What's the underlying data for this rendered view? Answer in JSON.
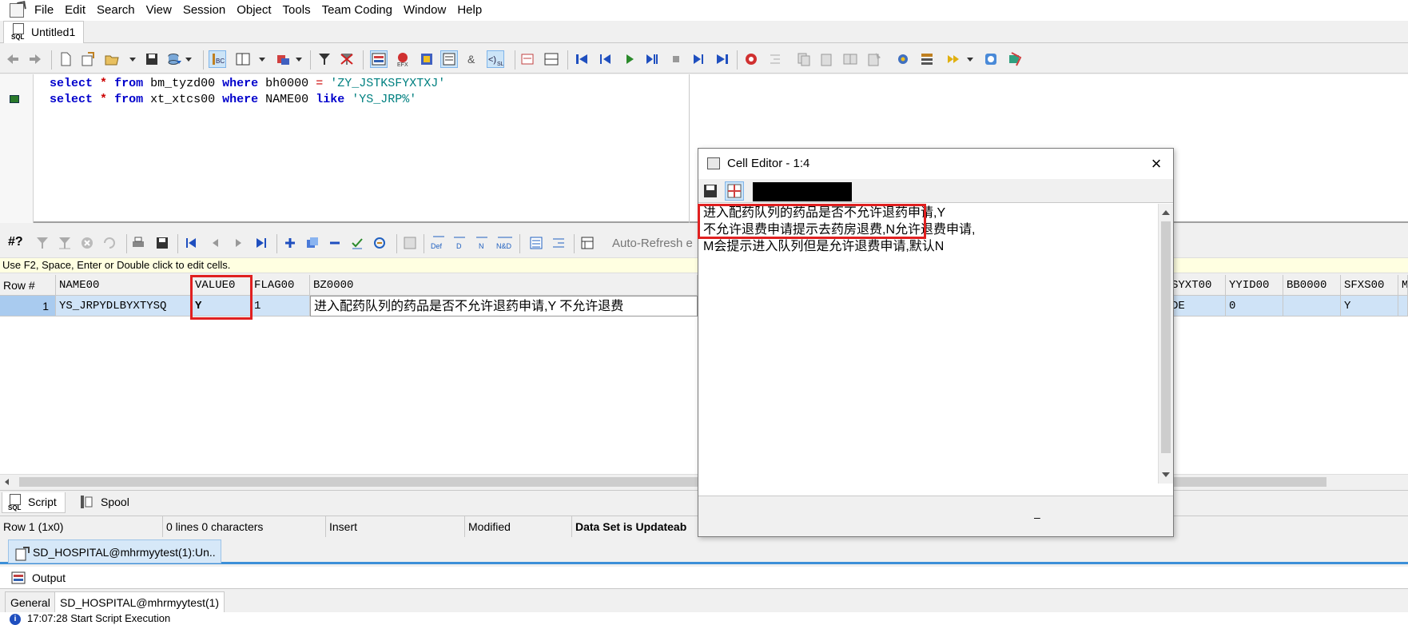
{
  "menu": {
    "items": [
      "File",
      "Edit",
      "Search",
      "View",
      "Session",
      "Object",
      "Tools",
      "Team Coding",
      "Window",
      "Help"
    ]
  },
  "doc_tab": {
    "title": "Untitled1",
    "icon": "sql-file-icon"
  },
  "editor": {
    "lines": [
      {
        "kw1": "select",
        "star": "*",
        "kw2": "from",
        "table": "bm_tyzd00",
        "kw3": "where",
        "col": "bh0000",
        "op": "=",
        "literal": "'ZY_JSTKSFYXTXJ'"
      },
      {
        "kw1": "select",
        "star": "*",
        "kw2": "from",
        "table": "xt_xtcs00",
        "kw3": "where",
        "col": "NAME00",
        "op": "like",
        "literal": "'YS_JRP%'"
      }
    ]
  },
  "grid_toolbar": {
    "label_hash": "#?",
    "def": "Def",
    "d": "D",
    "n": "N",
    "nd": "N&D",
    "auto_refresh": "Auto-Refresh e"
  },
  "hint": "Use F2, Space, Enter or Double click to edit cells.",
  "grid": {
    "columns": [
      "Row #",
      "NAME00",
      "VALUE0",
      "FLAG00",
      "BZ0000",
      "SYXT00",
      "YYID00",
      "BB0000",
      "SFXS00",
      "M"
    ],
    "row": {
      "row_num": "1",
      "name": "YS_JRPYDLBYXTYSQ",
      "value": "Y",
      "flag": "1",
      "bz": "进入配药队列的药品是否不允许退药申请,Y 不允许退费",
      "syxt_partial": "DE",
      "yyid": "0",
      "bb": "",
      "sfxs": "Y"
    }
  },
  "bottom_tabs": {
    "script": "Script",
    "spool": "Spool"
  },
  "status": {
    "position": "Row 1 (1x0)",
    "lines": "0 lines 0 characters",
    "mode": "Insert",
    "modified": "Modified",
    "dataset": "Data Set is Updateab"
  },
  "connection_tab": "SD_HOSPITAL@mhrmyytest(1):Un..",
  "output": {
    "title": "Output",
    "tabs": [
      "General",
      "SD_HOSPITAL@mhrmyytest(1)"
    ],
    "log": "17:07:28  Start Script Execution"
  },
  "cell_editor": {
    "title": "Cell Editor - 1:4",
    "lines": [
      "进入配药队列的药品是否不允许退药申请,Y",
      "不允许退费申请提示去药房退费,N允许退费申请,",
      "M会提示进入队列但是允许退费申请,默认N"
    ],
    "close": "×",
    "bottom_glyph": "–"
  },
  "colors": {
    "selection": "#cfe3f7",
    "highlight_box": "#e02020",
    "keyword": "#0000cc",
    "string_literal": "#008080",
    "accent_blue": "#3c8fd8"
  }
}
